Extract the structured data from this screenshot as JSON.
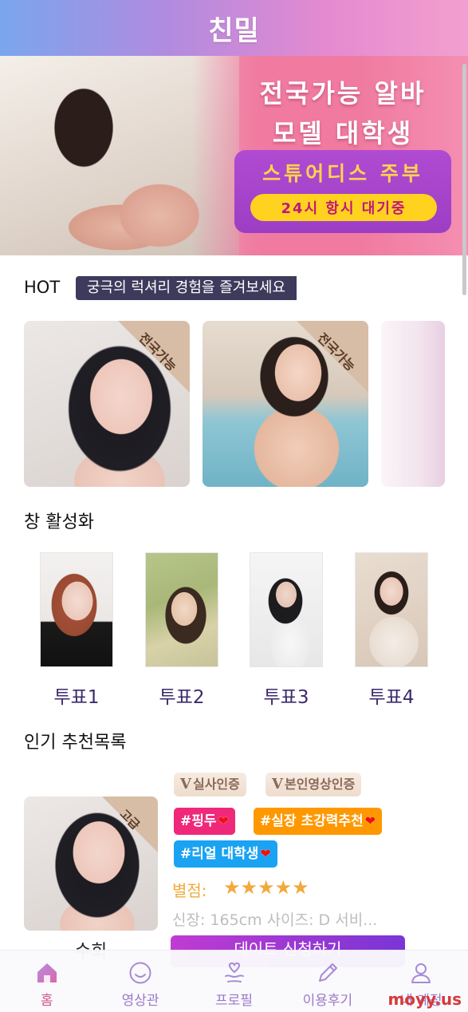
{
  "header": {
    "title": "친밀"
  },
  "banner": {
    "line1": "전국가능 알바",
    "line2": "모델 대학생",
    "sub": "스튜어디스 주부",
    "pill": "24시 항시 대기중"
  },
  "hot": {
    "label": "HOT",
    "slogan": "궁극의 럭셔리 경험을 즐겨보세요",
    "cards": [
      {
        "ribbon": "전국가능"
      },
      {
        "ribbon": "전국가능"
      }
    ]
  },
  "vote": {
    "title": "창 활성화",
    "items": [
      "투표1",
      "투표2",
      "투표3",
      "투표4"
    ]
  },
  "recommend": {
    "title": "인기 추천목록",
    "item": {
      "ribbon": "고급",
      "name": "수희",
      "badges": [
        "실사인증",
        "본인영상인증"
      ],
      "badge_mark": "V",
      "tags": [
        {
          "text": "#핑두",
          "color": "#f0287a"
        },
        {
          "text": "#실장 초강력추천",
          "color": "#ff9800"
        },
        {
          "text": "#리얼 대학생",
          "color": "#1aa3f2"
        }
      ],
      "rating_label": "별점:",
      "rating": 5,
      "stars": "★★★★★",
      "spec": "신장: 165cm 사이즈: D 서비...",
      "apply_label": "데이트 신청하기"
    }
  },
  "nav": {
    "items": [
      {
        "label": "홈",
        "icon": "home-icon",
        "active": true
      },
      {
        "label": "영상관",
        "icon": "smile-icon",
        "active": false
      },
      {
        "label": "프로필",
        "icon": "heart-hand-icon",
        "active": false
      },
      {
        "label": "이용후기",
        "icon": "pencil-icon",
        "active": false
      },
      {
        "label": "내 계정",
        "icon": "user-icon",
        "active": false
      }
    ]
  },
  "watermark": "moyy.us",
  "colors": {
    "accent": "#9a79c9",
    "active": "#d0578f",
    "star": "#f2a93b"
  }
}
